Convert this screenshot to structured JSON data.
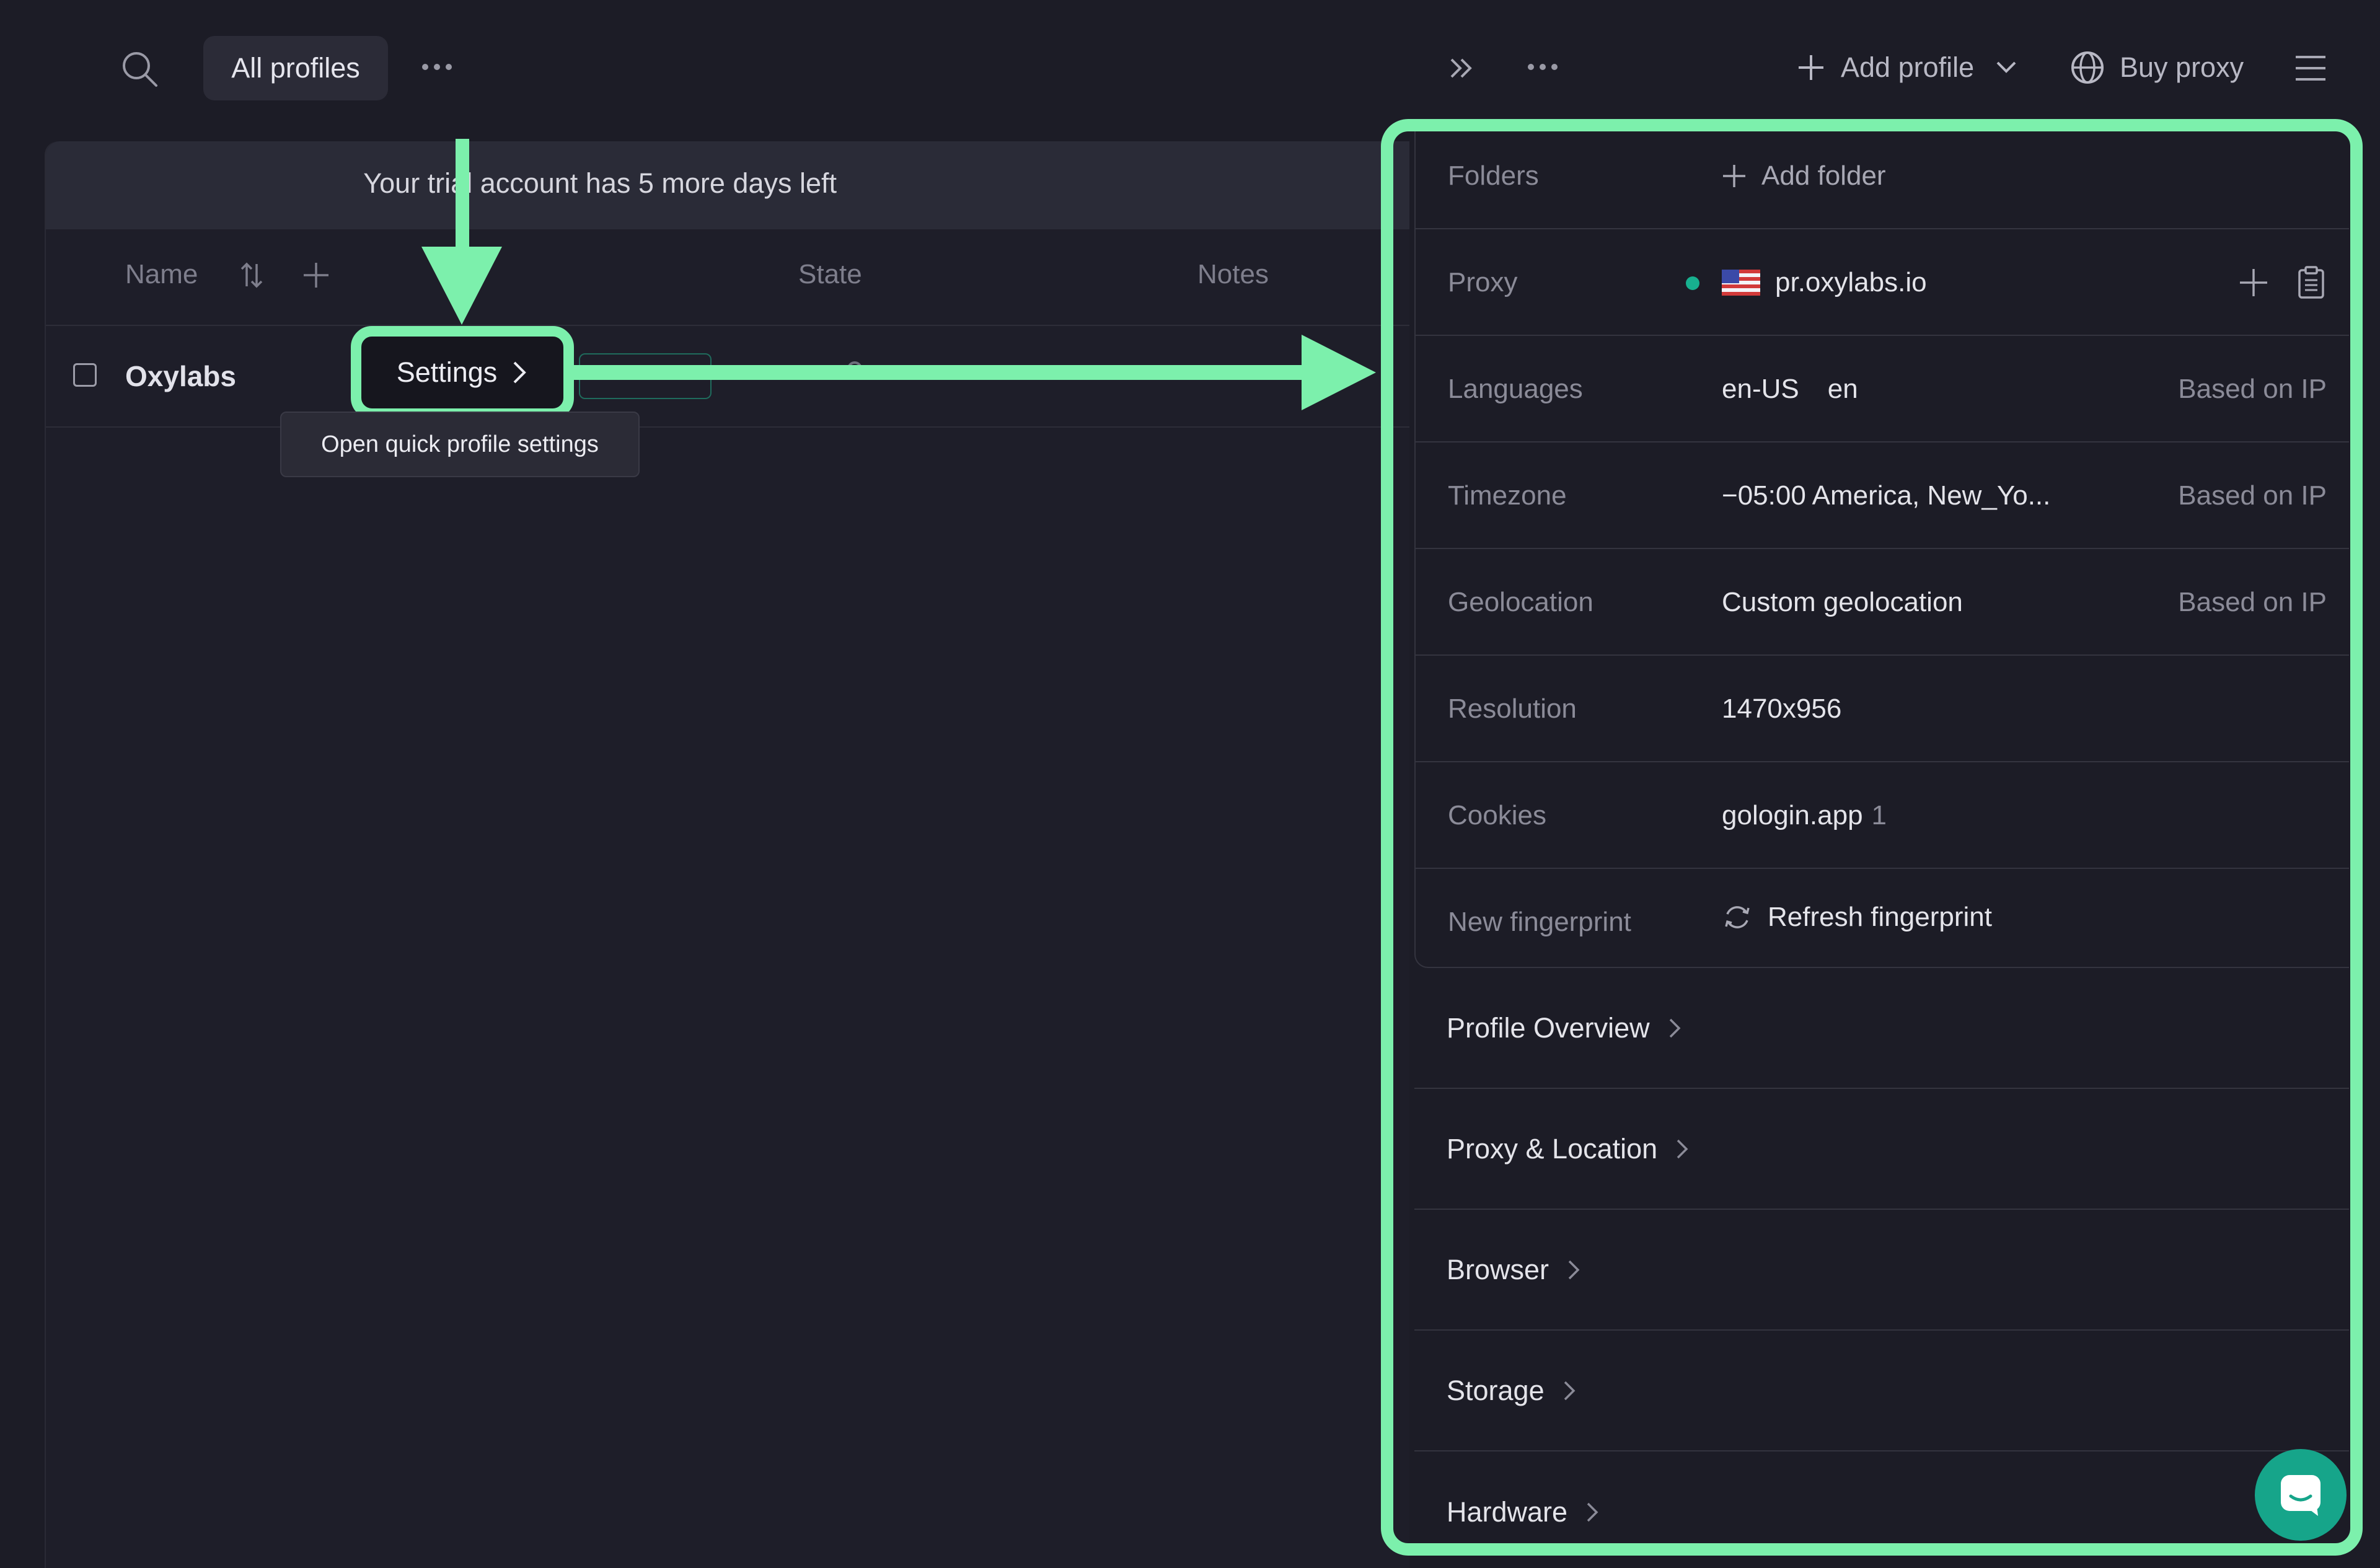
{
  "topbar": {
    "all_profiles": "All profiles",
    "add_profile": "Add profile",
    "buy_proxy": "Buy proxy"
  },
  "trial_banner": "Your trial account has 5 more days left",
  "table": {
    "headers": {
      "name": "Name",
      "state": "State",
      "notes": "Notes"
    },
    "row": {
      "name": "Oxylabs"
    }
  },
  "settings_button": "Settings",
  "tooltip": "Open quick profile settings",
  "panel": {
    "folders": {
      "label": "Folders",
      "action": "Add folder"
    },
    "proxy": {
      "label": "Proxy",
      "value": "pr.oxylabs.io",
      "status_color": "#17b08f"
    },
    "languages": {
      "label": "Languages",
      "value1": "en-US",
      "value2": "en",
      "source": "Based on IP"
    },
    "timezone": {
      "label": "Timezone",
      "value": "−05:00 America, New_Yo...",
      "source": "Based on IP"
    },
    "geolocation": {
      "label": "Geolocation",
      "value": "Custom geolocation",
      "source": "Based on IP"
    },
    "resolution": {
      "label": "Resolution",
      "value": "1470x956"
    },
    "cookies": {
      "label": "Cookies",
      "value": "gologin.app",
      "count": "1"
    },
    "fingerprint": {
      "label": "New fingerprint",
      "action": "Refresh fingerprint"
    },
    "sections": [
      "Profile Overview",
      "Proxy & Location",
      "Browser",
      "Storage",
      "Hardware"
    ]
  },
  "colors": {
    "highlight": "#7cf0ac",
    "accent": "#17b08f",
    "background": "#1c1c26"
  }
}
